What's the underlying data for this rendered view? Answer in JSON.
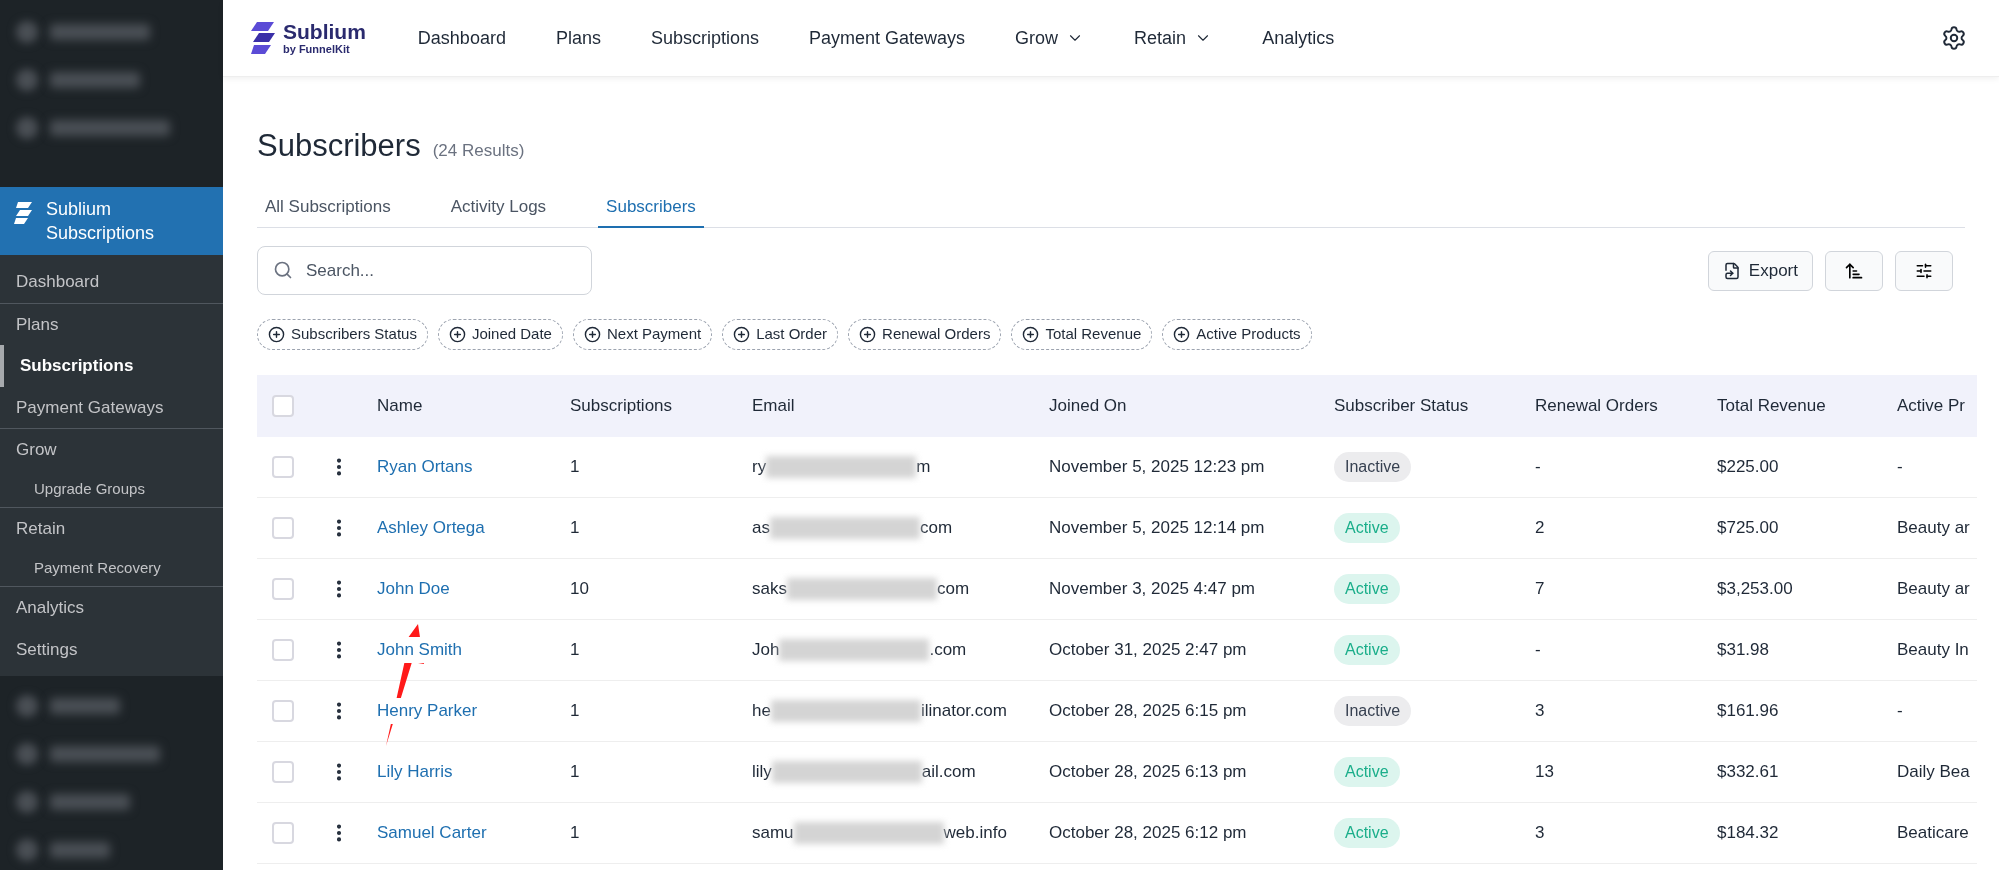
{
  "sidebar": {
    "plugin_title": "Sublium Subscriptions",
    "sections": [
      [
        {
          "label": "Dashboard",
          "selected": false
        }
      ],
      [
        {
          "label": "Plans",
          "selected": false
        },
        {
          "label": "Subscriptions",
          "selected": true
        },
        {
          "label": "Payment Gateways",
          "selected": false
        }
      ],
      [
        {
          "label": "Grow",
          "selected": false,
          "children": [
            {
              "label": "Upgrade Groups",
              "selected": false
            }
          ]
        }
      ],
      [
        {
          "label": "Retain",
          "selected": false,
          "children": [
            {
              "label": "Payment Recovery",
              "selected": false
            }
          ]
        }
      ],
      [
        {
          "label": "Analytics",
          "selected": false
        },
        {
          "label": "Settings",
          "selected": false
        }
      ]
    ]
  },
  "header": {
    "brand": "Sublium",
    "byline": "by FunnelKit",
    "nav": [
      {
        "label": "Dashboard",
        "dropdown": false
      },
      {
        "label": "Plans",
        "dropdown": false
      },
      {
        "label": "Subscriptions",
        "dropdown": false
      },
      {
        "label": "Payment Gateways",
        "dropdown": false
      },
      {
        "label": "Grow",
        "dropdown": true
      },
      {
        "label": "Retain",
        "dropdown": true
      },
      {
        "label": "Analytics",
        "dropdown": false
      }
    ]
  },
  "page": {
    "title": "Subscribers",
    "count": "(24 Results)"
  },
  "tabs": [
    {
      "label": "All Subscriptions",
      "selected": false
    },
    {
      "label": "Activity Logs",
      "selected": false
    },
    {
      "label": "Subscribers",
      "selected": true
    }
  ],
  "search": {
    "placeholder": "Search..."
  },
  "export_button": "Export",
  "filters": [
    "Subscribers Status",
    "Joined Date",
    "Next Payment",
    "Last Order",
    "Renewal Orders",
    "Total Revenue",
    "Active Products"
  ],
  "table": {
    "select_all_checked": false,
    "columns": [
      "Name",
      "Subscriptions",
      "Email",
      "Joined On",
      "Subscriber Status",
      "Renewal Orders",
      "Total Revenue",
      "Active Pr"
    ],
    "rows": [
      {
        "checked": false,
        "name": "Ryan Ortans",
        "subscriptions": "1",
        "email_start": "ry",
        "email_end": "m",
        "joined_on": "November 5, 2025 12:23 pm",
        "status": {
          "label": "Inactive",
          "kind": "inactive"
        },
        "renewal_orders": "-",
        "total_revenue": "$225.00",
        "active_products": "-"
      },
      {
        "checked": false,
        "name": "Ashley Ortega",
        "subscriptions": "1",
        "email_start": "as",
        "email_end": "com",
        "joined_on": "November 5, 2025 12:14 pm",
        "status": {
          "label": "Active",
          "kind": "active"
        },
        "renewal_orders": "2",
        "total_revenue": "$725.00",
        "active_products": "Beauty ar"
      },
      {
        "checked": false,
        "name": "John Doe",
        "subscriptions": "10",
        "email_start": "saks",
        "email_end": "com",
        "joined_on": "November 3, 2025 4:47 pm",
        "status": {
          "label": "Active",
          "kind": "active"
        },
        "renewal_orders": "7",
        "total_revenue": "$3,253.00",
        "active_products": "Beauty ar"
      },
      {
        "checked": false,
        "name": "John Smith",
        "subscriptions": "1",
        "email_start": "Joh",
        "email_end": ".com",
        "joined_on": "October 31, 2025 2:47 pm",
        "status": {
          "label": "Active",
          "kind": "active"
        },
        "renewal_orders": "-",
        "total_revenue": "$31.98",
        "active_products": "Beauty In"
      },
      {
        "checked": false,
        "name": "Henry Parker",
        "subscriptions": "1",
        "email_start": "he",
        "email_end": "ilinator.com",
        "joined_on": "October 28, 2025 6:15 pm",
        "status": {
          "label": "Inactive",
          "kind": "inactive"
        },
        "renewal_orders": "3",
        "total_revenue": "$161.96",
        "active_products": "-"
      },
      {
        "checked": false,
        "name": "Lily Harris",
        "subscriptions": "1",
        "email_start": "lily",
        "email_end": "ail.com",
        "joined_on": "October 28, 2025 6:13 pm",
        "status": {
          "label": "Active",
          "kind": "active"
        },
        "renewal_orders": "13",
        "total_revenue": "$332.61",
        "active_products": "Daily Bea"
      },
      {
        "checked": false,
        "name": "Samuel Carter",
        "subscriptions": "1",
        "email_start": "samu",
        "email_end": "web.info",
        "joined_on": "October 28, 2025 6:12 pm",
        "status": {
          "label": "Active",
          "kind": "active"
        },
        "renewal_orders": "3",
        "total_revenue": "$184.32",
        "active_products": "Beaticare"
      }
    ]
  }
}
